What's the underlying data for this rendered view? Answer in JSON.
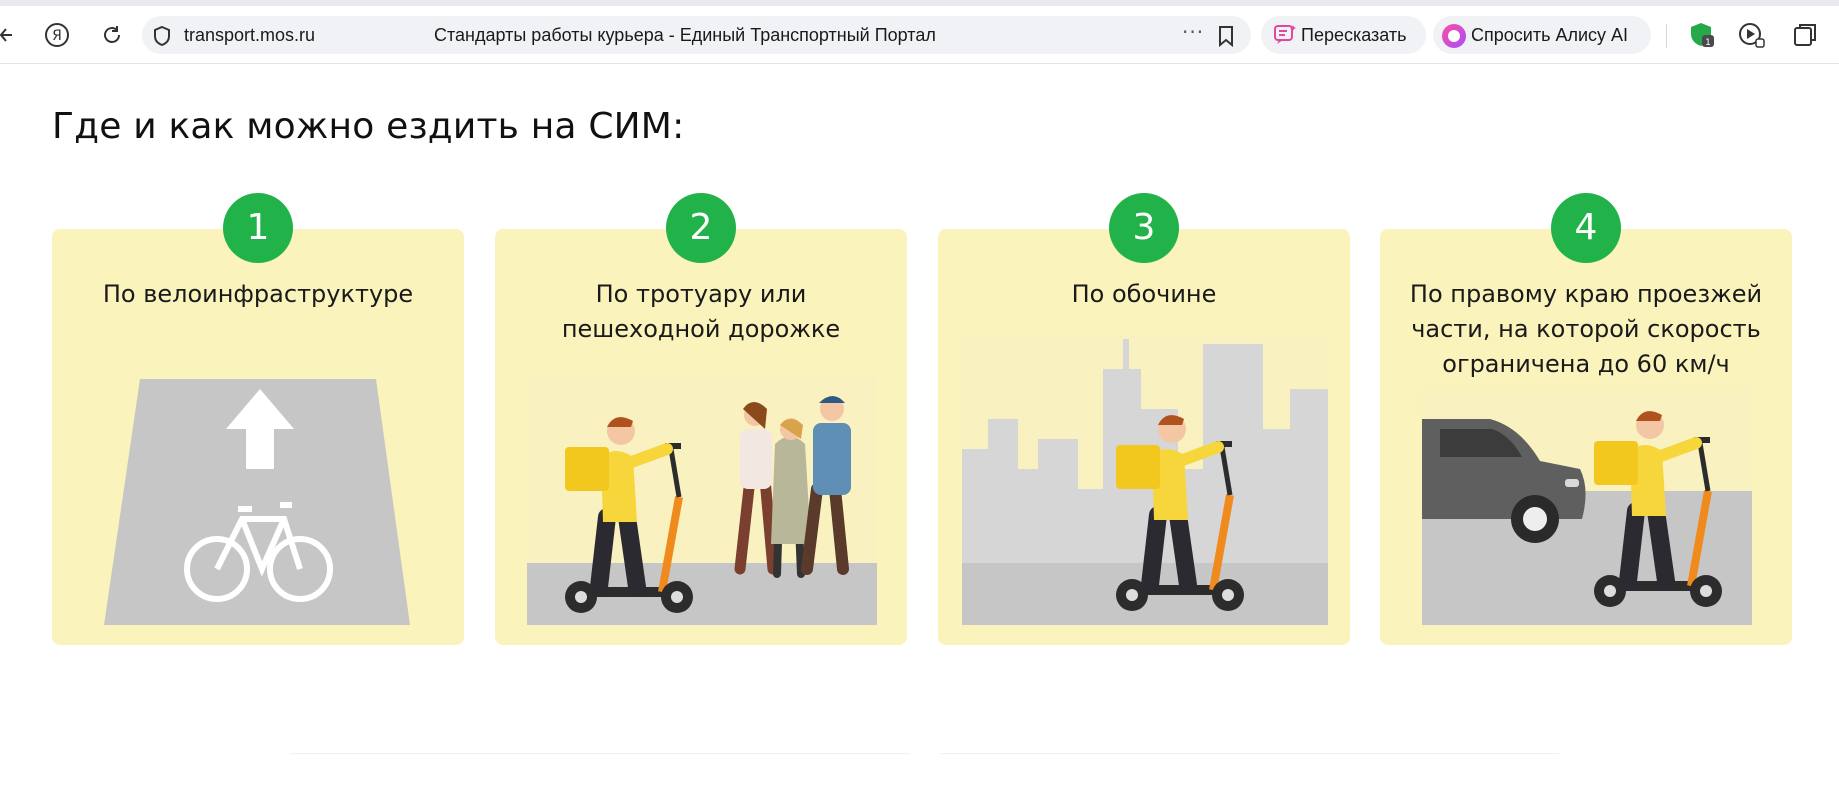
{
  "browser": {
    "address": {
      "host": "transport.mos.ru",
      "page_title": "Стандарты работы курьера - Единый Транспортный Портал"
    },
    "retell_label": "Пересказать",
    "ask_alice_label": "Спросить Алису AI",
    "extension_badge_count": "1",
    "icons": [
      "back-arrow-icon",
      "yandex-logo-icon",
      "reload-icon",
      "shield-icon",
      "more-dots-icon",
      "bookmark-icon",
      "retell-icon",
      "alice-icon",
      "protect-extension-icon",
      "play-ai-icon",
      "collections-icon"
    ]
  },
  "page": {
    "heading": "Где и как можно ездить на СИМ:",
    "cards": [
      {
        "number": "1",
        "text": "По велоинфраструктуре"
      },
      {
        "number": "2",
        "text": "По тротуару или\nпешеходной дорожке"
      },
      {
        "number": "3",
        "text": "По обочине"
      },
      {
        "number": "4",
        "text": "По правому краю проезжей\nчасти, на которой скорость\nограничена до 60 км/ч"
      }
    ]
  },
  "colors": {
    "card_bg": "#faf3bc",
    "badge_green": "#21b24a",
    "courier_yellow": "#f6d63a",
    "scooter_orange": "#f08a1c",
    "road_gray": "#c6c6c6"
  }
}
